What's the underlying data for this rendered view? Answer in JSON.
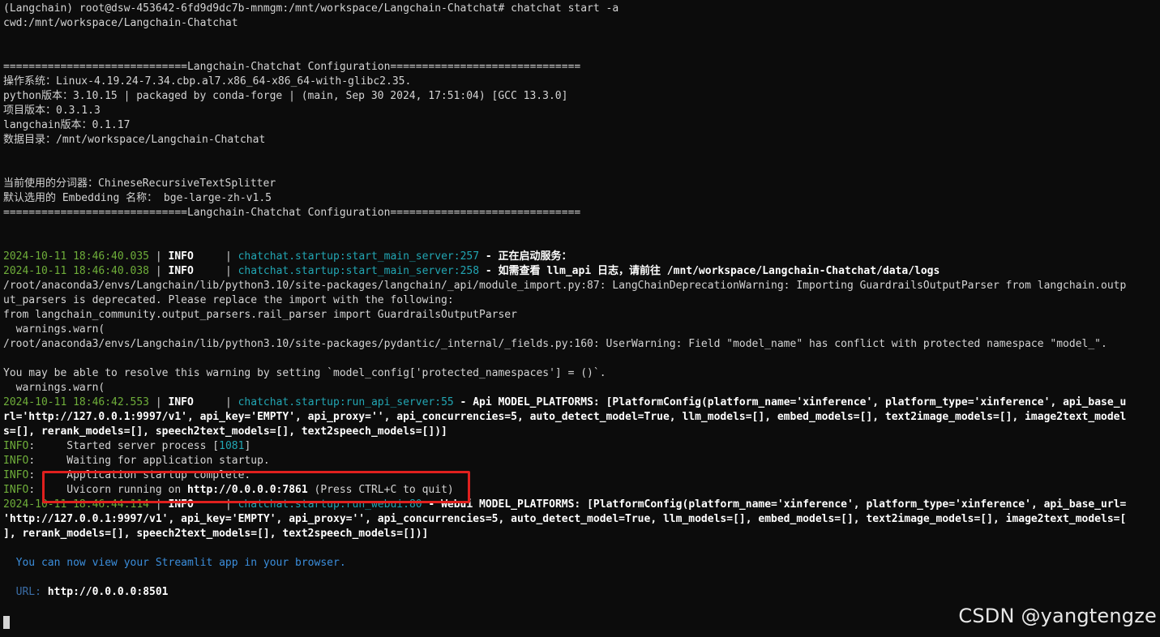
{
  "terminal": {
    "prompt_line": "(Langchain) root@dsw-453642-6fd9d9dc7b-mnmgm:/mnt/workspace/Langchain-Chatchat# chatchat start -a",
    "cwd_line": "cwd:/mnt/workspace/Langchain-Chatchat",
    "config_header": "=============================Langchain-Chatchat Configuration==============================",
    "os_line": "操作系统：Linux-4.19.24-7.34.cbp.al7.x86_64-x86_64-with-glibc2.35.",
    "python_line": "python版本：3.10.15 | packaged by conda-forge | (main, Sep 30 2024, 17:51:04) [GCC 13.3.0]",
    "project_line": "项目版本：0.3.1.3",
    "langchain_line": "langchain版本：0.1.17",
    "datadir_line": "数据目录：/mnt/workspace/Langchain-Chatchat",
    "splitter_line": "当前使用的分词器：ChineseRecursiveTextSplitter",
    "embedding_line": "默认选用的 Embedding 名称： bge-large-zh-v1.5",
    "config_footer": "=============================Langchain-Chatchat Configuration==============================",
    "log1": {
      "ts": "2024-10-11 18:46:40.035",
      "sep1": " | ",
      "level": "INFO",
      "sep2": "     | ",
      "module": "chatchat.startup",
      "func": ":start_main_server:",
      "lineno": "257",
      "msg": " - 正在启动服务："
    },
    "log2": {
      "ts": "2024-10-11 18:46:40.038",
      "sep1": " | ",
      "level": "INFO",
      "sep2": "     | ",
      "module": "chatchat.startup",
      "func": ":start_main_server:",
      "lineno": "258",
      "msg": " - 如需查看 llm_api 日志，请前往 /mnt/workspace/Langchain-Chatchat/data/logs"
    },
    "warn1_a": "/root/anaconda3/envs/Langchain/lib/python3.10/site-packages/langchain/_api/module_import.py:87: LangChainDeprecationWarning: Importing GuardrailsOutputParser from langchain.outp",
    "warn1_b": "ut_parsers is deprecated. Please replace the import with the following:",
    "warn1_c": "from langchain_community.output_parsers.rail_parser import GuardrailsOutputParser",
    "warn1_d": "  warnings.warn(",
    "warn2_a": "/root/anaconda3/envs/Langchain/lib/python3.10/site-packages/pydantic/_internal/_fields.py:160: UserWarning: Field \"model_name\" has conflict with protected namespace \"model_\".",
    "warn2_b": "You may be able to resolve this warning by setting `model_config['protected_namespaces'] = ()`.",
    "warn2_c": "  warnings.warn(",
    "log3": {
      "ts": "2024-10-11 18:46:42.553",
      "sep1": " | ",
      "level": "INFO",
      "sep2": "     | ",
      "module": "chatchat.startup",
      "func": ":run_api_server:",
      "lineno": "55",
      "msg": " - Api MODEL_PLATFORMS: [PlatformConfig(platform_name='xinference', platform_type='xinference', api_base_u",
      "cont1": "rl='http://127.0.0.1:9997/v1', api_key='EMPTY', api_proxy='', api_concurrencies=5, auto_detect_model=True, llm_models=[], embed_models=[], text2image_models=[], image2text_model",
      "cont2": "s=[], rerank_models=[], speech2text_models=[], text2speech_models=[])]"
    },
    "uv1": {
      "tag": "INFO",
      "msg_pre": ":     Started server process [",
      "pid": "1081",
      "msg_post": "]"
    },
    "uv2": {
      "tag": "INFO",
      "msg": ":     Waiting for application startup."
    },
    "uv3": {
      "tag": "INFO",
      "msg": ":     Application startup complete."
    },
    "uv4": {
      "tag": "INFO",
      "msg_pre": ":     Uvicorn running on ",
      "url": "http://0.0.0.0:7861",
      "msg_post": " (Press CTRL+C to quit)"
    },
    "log4": {
      "ts": "2024-10-11 18:46:44.114",
      "sep1": " | ",
      "level": "INFO",
      "sep2": "     | ",
      "module": "chatchat.startup",
      "func": ":run_webui:",
      "lineno": "80",
      "msg": " - Webui MODEL_PLATFORMS: [PlatformConfig(platform_name='xinference', platform_type='xinference', api_base_url=",
      "cont1": "'http://127.0.0.1:9997/v1', api_key='EMPTY', api_proxy='', api_concurrencies=5, auto_detect_model=True, llm_models=[], embed_models=[], text2image_models=[], image2text_models=[",
      "cont2": "], rerank_models=[], speech2text_models=[], text2speech_models=[])]"
    },
    "streamlit_msg": "  You can now view your Streamlit app in your browser.",
    "url_label": "  URL: ",
    "url_value": "http://0.0.0.0:8501"
  },
  "watermark": "CSDN @yangtengze",
  "colors": {
    "background": "#0c0c0c",
    "text": "#d4d4d4",
    "timestamp": "#6fae3a",
    "module": "#22a6b3",
    "highlight": "#e0201e"
  }
}
